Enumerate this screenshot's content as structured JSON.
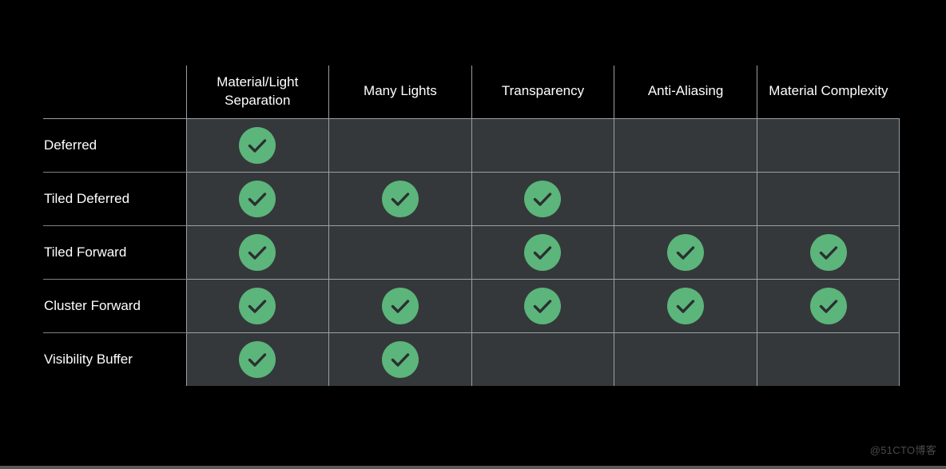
{
  "slide": {
    "background_color": "#000000",
    "accent_color": "#5cb57a",
    "grid_line_color": "#9aa0a3",
    "cell_fill_color": "#34383b"
  },
  "table": {
    "corner_label": "",
    "columns": [
      "Material/Light Separation",
      "Many Lights",
      "Transparency",
      "Anti-Aliasing",
      "Material Complexity"
    ],
    "rows": [
      {
        "label": "Deferred",
        "cells": [
          true,
          false,
          false,
          false,
          false
        ]
      },
      {
        "label": "Tiled Deferred",
        "cells": [
          true,
          true,
          true,
          false,
          false
        ]
      },
      {
        "label": "Tiled Forward",
        "cells": [
          true,
          false,
          true,
          true,
          true
        ]
      },
      {
        "label": "Cluster Forward",
        "cells": [
          true,
          true,
          true,
          true,
          true
        ]
      },
      {
        "label": "Visibility Buffer",
        "cells": [
          true,
          true,
          false,
          false,
          false
        ]
      }
    ],
    "check_icon_name": "check-circle-icon"
  },
  "watermark": {
    "text": "@51CTO博客"
  }
}
